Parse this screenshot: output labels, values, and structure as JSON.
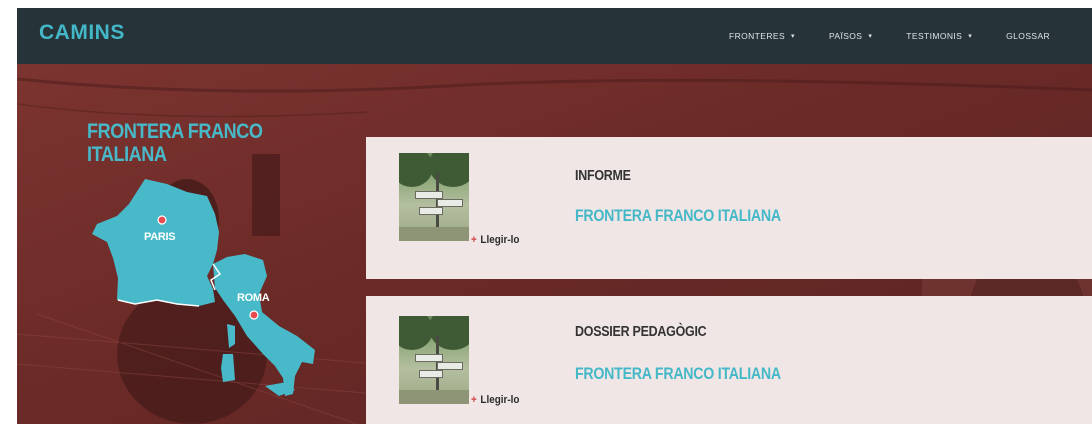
{
  "header": {
    "logo": "CAMINS",
    "nav": [
      {
        "label": "FRONTERES",
        "has_dropdown": true
      },
      {
        "label": "PAÏSOS",
        "has_dropdown": true
      },
      {
        "label": "TESTIMONIS",
        "has_dropdown": true
      },
      {
        "label": "GLOSSAR",
        "has_dropdown": false
      }
    ],
    "caret": "▾"
  },
  "hero": {
    "title_line1": "FRONTERA FRANCO",
    "title_line2": "ITALIANA",
    "map": {
      "cities": [
        "PARIS",
        "ROMA"
      ],
      "country_color": "#48b9c9",
      "marker_color": "#e84a52"
    }
  },
  "cards": [
    {
      "category": "INFORME",
      "title": "FRONTERA FRANCO ITALIANA",
      "read_plus": "+",
      "read_label": "Llegir-lo"
    },
    {
      "category": "DOSSIER PEDAGÒGIC",
      "title": "FRONTERA FRANCO ITALIANA",
      "read_plus": "+",
      "read_label": "Llegir-lo"
    }
  ],
  "colors": {
    "header_bg": "#263339",
    "accent": "#45b8c8",
    "hero_bg": "#6e2d29",
    "card_bg": "#f1e6e6",
    "plus": "#d43d3d"
  }
}
